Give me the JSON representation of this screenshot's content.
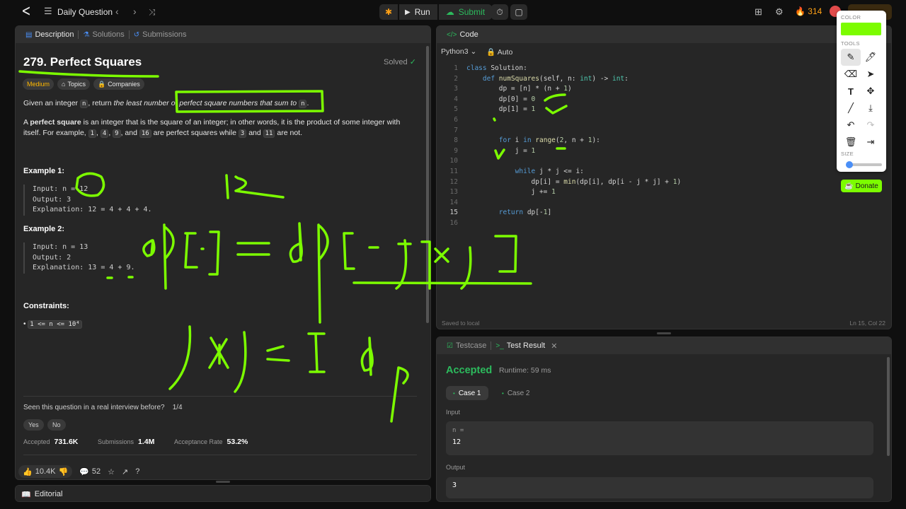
{
  "topbar": {
    "title": "Daily Question",
    "run_label": "Run",
    "submit_label": "Submit",
    "streak": "314"
  },
  "description": {
    "tabs": [
      "Description",
      "Solutions",
      "Submissions"
    ],
    "number_title": "279. Perfect Squares",
    "solved_label": "Solved",
    "difficulty": "Medium",
    "topics_label": "Topics",
    "companies_label": "Companies",
    "statement_1a": "Given an integer ",
    "statement_1b": ", return ",
    "statement_1c": "the least number of perfect square numbers that sum to ",
    "var_n": "n",
    "statement_1d": ".",
    "statement_2a": "A ",
    "statement_2b": "perfect square",
    "statement_2c": " is an integer that is the square of an integer; in other words, it is the product of some integer with itself. For example, ",
    "ex_1": "1",
    "ex_4": "4",
    "ex_9": "9",
    "ex_16": "16",
    "statement_2d": " are perfect squares while ",
    "ex_3": "3",
    "ex_11": "11",
    "statement_2e": " are not.",
    "and_1": ", and ",
    "comma": ", ",
    "and_2": " and ",
    "example1_title": "Example 1:",
    "example1_lines": [
      "Input: n = 12",
      "Output: 3",
      "Explanation: 12 = 4 + 4 + 4."
    ],
    "example2_title": "Example 2:",
    "example2_lines": [
      "Input: n = 13",
      "Output: 2",
      "Explanation: 13 = 4 + 9."
    ],
    "constraints_title": "Constraints:",
    "constraint": "1 <= n <= 10⁴",
    "interview_question": "Seen this question in a real interview before?",
    "interview_count": "1/4",
    "yes_label": "Yes",
    "no_label": "No",
    "accepted_label": "Accepted",
    "accepted_value": "731.6K",
    "submissions_label": "Submissions",
    "submissions_value": "1.4M",
    "acceptance_label": "Acceptance Rate",
    "acceptance_value": "53.2%",
    "likes": "10.4K",
    "comments": "52",
    "editorial_label": "Editorial"
  },
  "code": {
    "tab_label": "Code",
    "language": "Python3",
    "auto_label": "Auto",
    "line_numbers": [
      "1",
      "2",
      "3",
      "4",
      "5",
      "6",
      "7",
      "8",
      "9",
      "10",
      "11",
      "12",
      "13",
      "14",
      "15",
      "16"
    ],
    "lines": [
      "class Solution:",
      "    def numSquares(self, n: int) -> int:",
      "        dp = [n] * (n + 1)",
      "        dp[0] = 0",
      "        dp[1] = 1",
      "",
      "",
      "        for i in range(2, n + 1):",
      "            j = 1",
      "",
      "            while j * j <= i:",
      "                dp[i] = min(dp[i], dp[i - j * j] + 1)",
      "                j += 1",
      "",
      "        return dp[-1]",
      ""
    ],
    "saved_status": "Saved to local",
    "cursor_pos": "Ln 15, Col 22"
  },
  "test": {
    "tabs": [
      "Testcase",
      "Test Result"
    ],
    "verdict": "Accepted",
    "runtime": "Runtime: 59 ms",
    "cases": [
      "Case 1",
      "Case 2"
    ],
    "input_label": "Input",
    "input_var": "n =",
    "input_value": "12",
    "output_label": "Output",
    "output_value": "3"
  },
  "draw_tools": {
    "color_label": "COLOR",
    "tools_label": "TOOLS",
    "size_label": "SIZE",
    "color": "#7cfc00",
    "size_level": 0.1,
    "donate_label": "Donate"
  },
  "colors": {
    "accent_green": "#2cbb5d",
    "difficulty_medium": "#ffb800",
    "annotation": "#7cfc00"
  }
}
